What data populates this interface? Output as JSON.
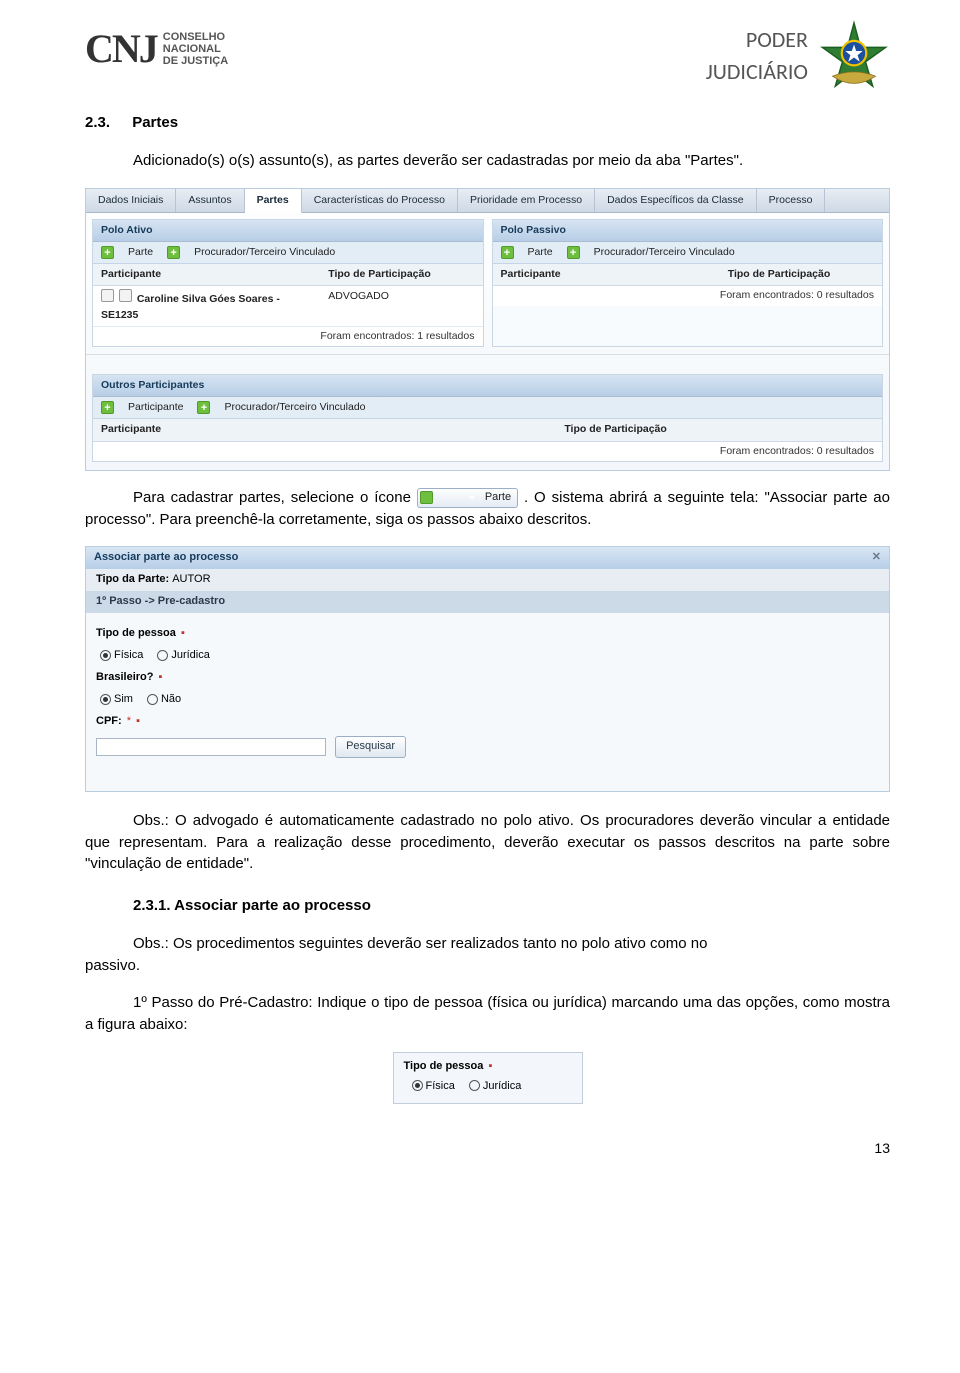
{
  "header": {
    "org_abbr": "CNJ",
    "org_line1": "CONSELHO",
    "org_line2": "NACIONAL",
    "org_line3": "DE JUSTIÇA",
    "power_line1": "PODER",
    "power_line2": "JUDICIÁRIO"
  },
  "section": {
    "number": "2.3.",
    "title": "Partes"
  },
  "para1": "Adicionado(s) o(s) assunto(s), as partes deverão ser cadastradas por meio da aba \"Partes\".",
  "para2a": "Para cadastrar partes, selecione o ícone ",
  "para2b": ". O sistema abrirá a seguinte tela: \"Associar parte ao processo\". Para preenchê-la corretamente, siga os passos abaixo descritos.",
  "parte_btn_label": "Parte",
  "ss1": {
    "tabs": [
      "Dados Iniciais",
      "Assuntos",
      "Partes",
      "Características do Processo",
      "Prioridade em Processo",
      "Dados Específicos da Classe",
      "Processo"
    ],
    "selected_tab_index": 2,
    "polo_ativo": {
      "title": "Polo Ativo"
    },
    "polo_passivo": {
      "title": "Polo Passivo"
    },
    "sub": {
      "parte": "Parte",
      "proc": "Procurador/Terceiro Vinculado"
    },
    "col": {
      "participante": "Participante",
      "tipo": "Tipo de Participação"
    },
    "ativo_row": {
      "participante": "Caroline Silva Góes Soares - SE1235",
      "tipo": "ADVOGADO"
    },
    "ativo_foot": "Foram encontrados: 1 resultados",
    "passivo_foot": "Foram encontrados: 0 resultados",
    "outros": {
      "title": "Outros Participantes",
      "participante": "Participante",
      "proc": "Procurador/Terceiro Vinculado",
      "col_part": "Participante",
      "col_tipo": "Tipo de Participação",
      "foot": "Foram encontrados: 0 resultados"
    }
  },
  "obs1": "Obs.: O advogado é automaticamente cadastrado no polo ativo. Os procuradores deverão vincular a entidade que representam. Para a realização desse procedimento, deverão executar os passos descritos na parte sobre \"vinculação de entidade\".",
  "subsection": {
    "number": "2.3.1.",
    "title": "Associar parte ao processo"
  },
  "obs2_start": "Obs.: Os procedimentos seguintes deverão ser realizados tanto no polo ativo como no ",
  "obs2_end": "passivo.",
  "para3": "1º Passo do Pré-Cadastro: Indique o tipo de pessoa (física ou jurídica) marcando uma das opções, como mostra a figura abaixo:",
  "ss2": {
    "title": "Associar parte ao processo",
    "tipo_parte_label": "Tipo da Parte:",
    "tipo_parte_value": "AUTOR",
    "step": "1º Passo -> Pre-cadastro",
    "tipo_pessoa_label": "Tipo de pessoa",
    "opt_fisica": "Física",
    "opt_juridica": "Jurídica",
    "brasileiro_label": "Brasileiro?",
    "opt_sim": "Sim",
    "opt_nao": "Não",
    "cpf_label": "CPF:",
    "btn_pesquisar": "Pesquisar"
  },
  "tipo_box": {
    "label": "Tipo de pessoa",
    "opt_fisica": "Física",
    "opt_juridica": "Jurídica"
  },
  "page_number": "13"
}
